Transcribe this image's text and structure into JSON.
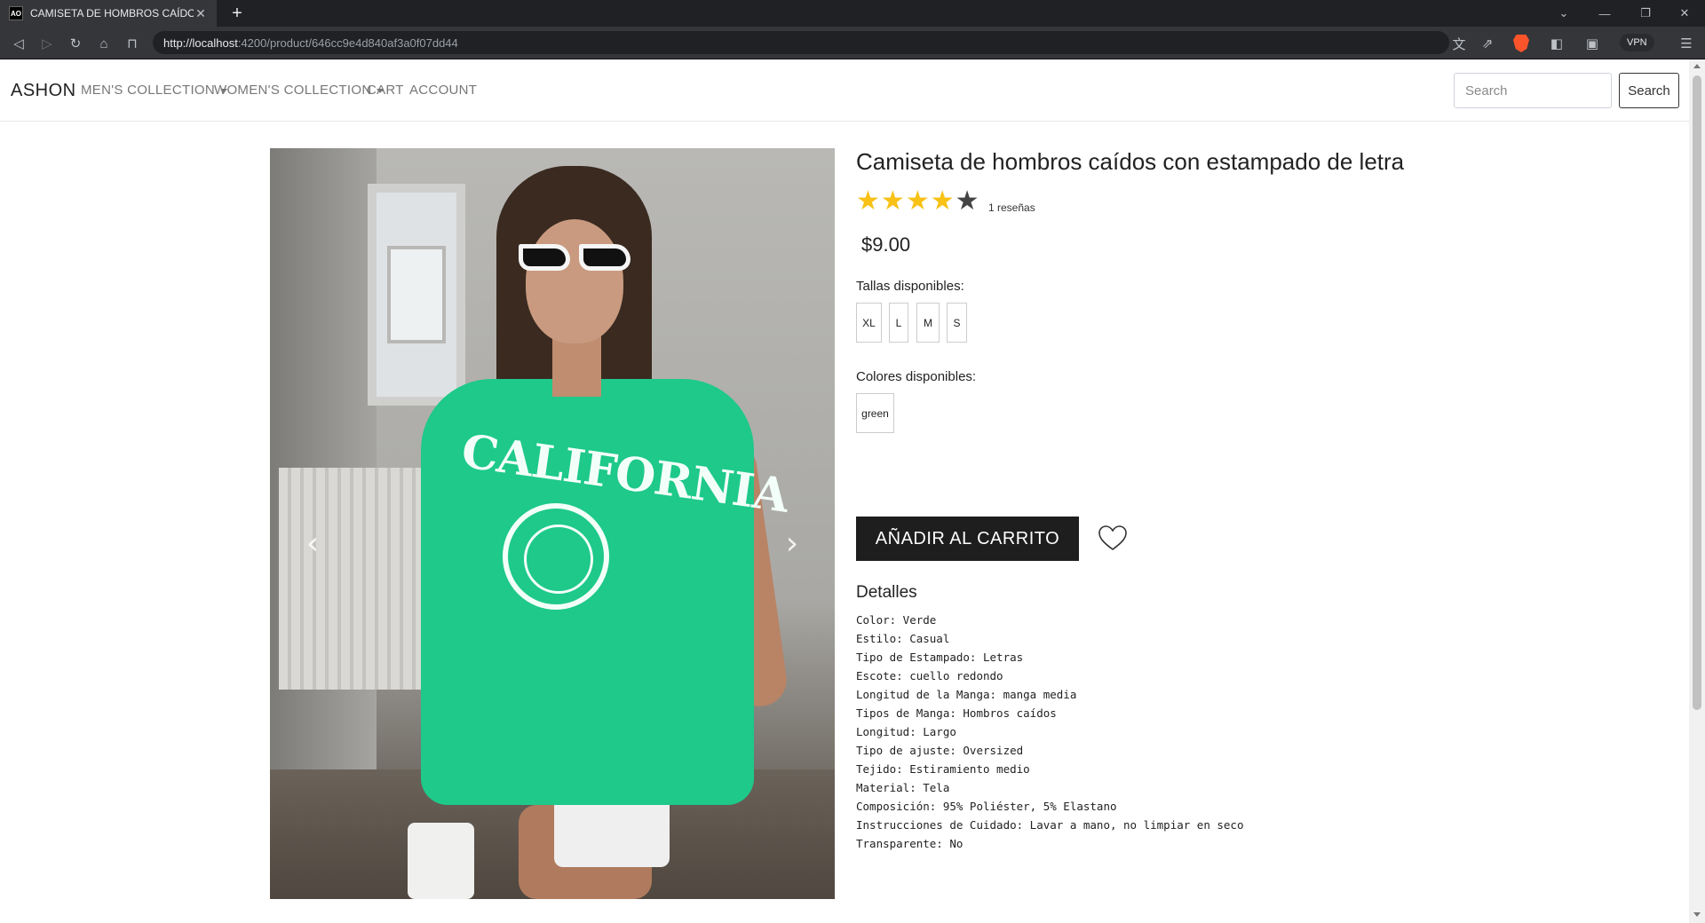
{
  "browser": {
    "tab_title": "CAMISETA DE HOMBROS CAÍDOS",
    "favicon_text": "AO",
    "url_host": "http://localhost",
    "url_rest": ":4200/product/646cc9e4d840af3a0f07dd44",
    "vpn_label": "VPN"
  },
  "nav": {
    "brand": "ASHON",
    "links": [
      "MEN'S COLLECTION",
      "WOMEN'S COLLECTION",
      "CART",
      "ACCOUNT"
    ],
    "search_placeholder": "Search",
    "search_button": "Search"
  },
  "product": {
    "title": "Camiseta de hombros caídos con estampado de letra",
    "rating": 4,
    "rating_max": 5,
    "reviews": "1 reseñas",
    "price": "$9.00",
    "sizes_label": "Tallas disponibles:",
    "sizes": [
      "XL",
      "L",
      "M",
      "S"
    ],
    "colors_label": "Colores disponibles:",
    "colors": [
      "green"
    ],
    "add_to_cart": "AÑADIR AL CARRITO",
    "details_heading": "Detalles",
    "details": [
      "Color: Verde",
      "Estilo: Casual",
      "Tipo de Estampado: Letras",
      "Escote: cuello redondo",
      "Longitud de la Manga: manga media",
      "Tipos de Manga: Hombros caídos",
      "Longitud: Largo",
      "Tipo de ajuste: Oversized",
      "Tejido: Estiramiento medio",
      "Material: Tela",
      "Composición: 95% Poliéster, 5% Elastano",
      "Instrucciones de Cuidado: Lavar a mano, no limpiar en seco",
      "Transparente: No"
    ],
    "image_print_text": "CALIFORNIA",
    "image_alt": "Camiseta de hombros caídos con estampado de letra"
  },
  "colors": {
    "accent_star": "#f8c115",
    "button_bg": "#1e1e1e",
    "shirt": "#1ec98a"
  }
}
